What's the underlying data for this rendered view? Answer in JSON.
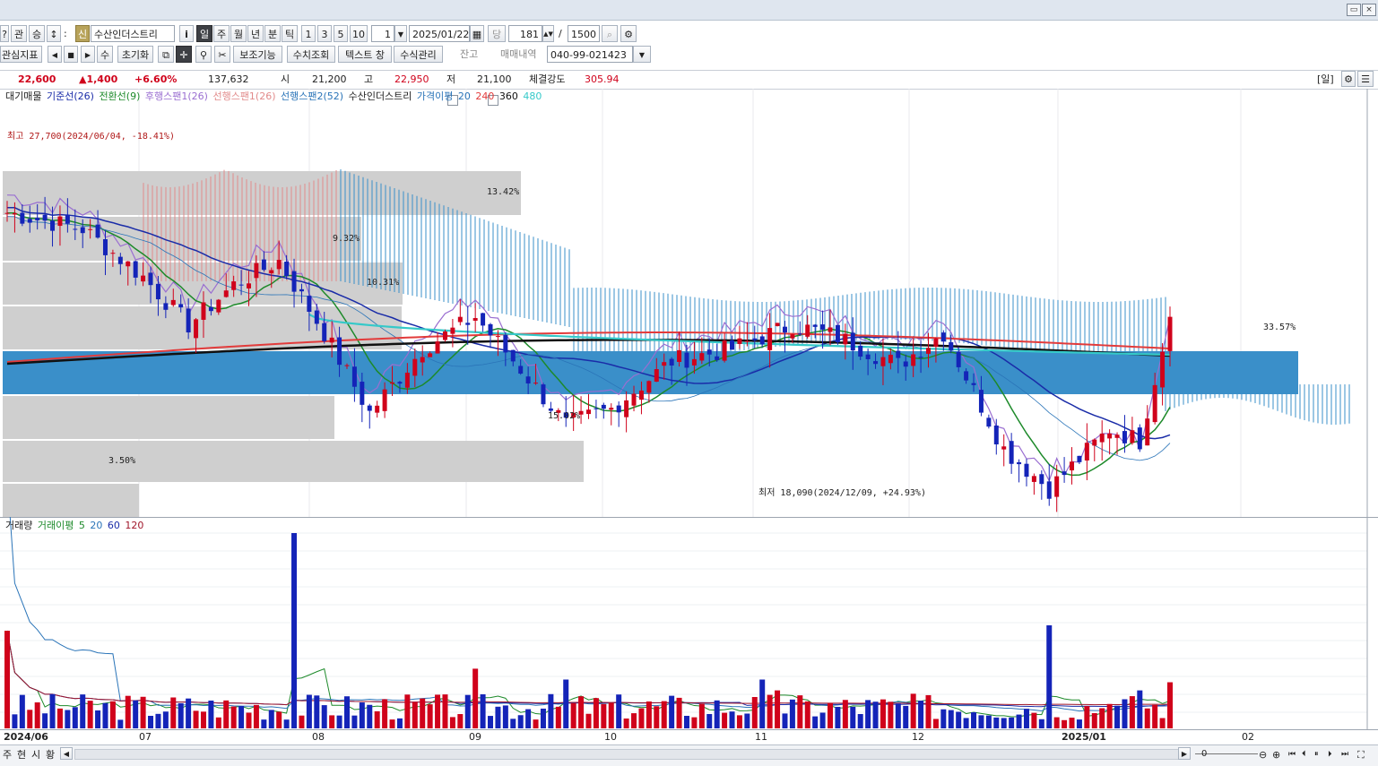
{
  "window": {
    "title_icons": [
      "restore-icon",
      "close-icon"
    ]
  },
  "toolbar1": {
    "btn_refresh": "?",
    "btn_kwan": "관",
    "btn_seung": "승",
    "btn_updown": "↕",
    "btn_colon": ":",
    "badge_new": "신",
    "stock_name": "수산인더스트리",
    "btn_info": "i",
    "periods": [
      "일",
      "주",
      "월",
      "년",
      "분",
      "틱"
    ],
    "active_period": "일",
    "intervals": [
      "1",
      "3",
      "5",
      "10"
    ],
    "interval_value": "1",
    "date": "2025/01/22",
    "btn_dang": "당",
    "count": "181",
    "slash": "/",
    "total": "1500"
  },
  "toolbar2": {
    "indicator_label": "관심지표",
    "btn_su": "수",
    "btn_reset": "초기화",
    "btn_assist": "보조기능",
    "btn_numeric": "수치조회",
    "btn_textwin": "텍스트 창",
    "btn_formula": "수식관리",
    "chk_balance": "잔고",
    "chk_trades": "매매내역",
    "account": "040-99-021423"
  },
  "quote": {
    "price": "22,600",
    "change": "▲1,400",
    "change_pct": "+6.60%",
    "volume": "137,632",
    "open_label": "시",
    "open": "21,200",
    "high_label": "고",
    "high": "22,950",
    "low_label": "저",
    "low": "21,100",
    "strength_label": "체결강도",
    "strength": "305.94",
    "period_tag": "[일]"
  },
  "price_legend": [
    "대기매물",
    "기준선(26)",
    "전환선(9)",
    "후행스팬1(26)",
    "선행스팬1(26)",
    "선행스팬2(52)",
    "수산인더스트리",
    "가격이평",
    "20",
    "240",
    "360",
    "480"
  ],
  "volume_legend": [
    "거래량",
    "거래이평",
    "5",
    "20",
    "60",
    "120"
  ],
  "annotations": {
    "high": "최고 27,700(2024/06/04, -18.41%)",
    "low": "최저 18,090(2024/12/09, +24.93%)",
    "pct_1342": "13.42%",
    "pct_932": "9.32%",
    "pct_1031": "10.31%",
    "pct_3357": "33.57%",
    "pct_1502": "15.02%",
    "pct_350": "3.50%"
  },
  "x_labels": [
    "2024/06",
    "07",
    "08",
    "09",
    "10",
    "11",
    "12",
    "2025/01",
    "02"
  ],
  "bottom": {
    "tabs": [
      "주",
      "현",
      "시",
      "황"
    ],
    "zoom_value": "0"
  },
  "colors": {
    "up": "#d0021b",
    "down": "#1424b8",
    "profile": "#3a8fc9",
    "profile_grey": "#cfcfcf"
  },
  "chart_data": {
    "type": "candlestick",
    "title": "수산인더스트리",
    "x_start": "2024/06",
    "x_end": "2025/01/22",
    "ylim": [
      17600,
      28300
    ],
    "candles_count": 155,
    "last_close": 22600,
    "volume_bars": 155
  }
}
